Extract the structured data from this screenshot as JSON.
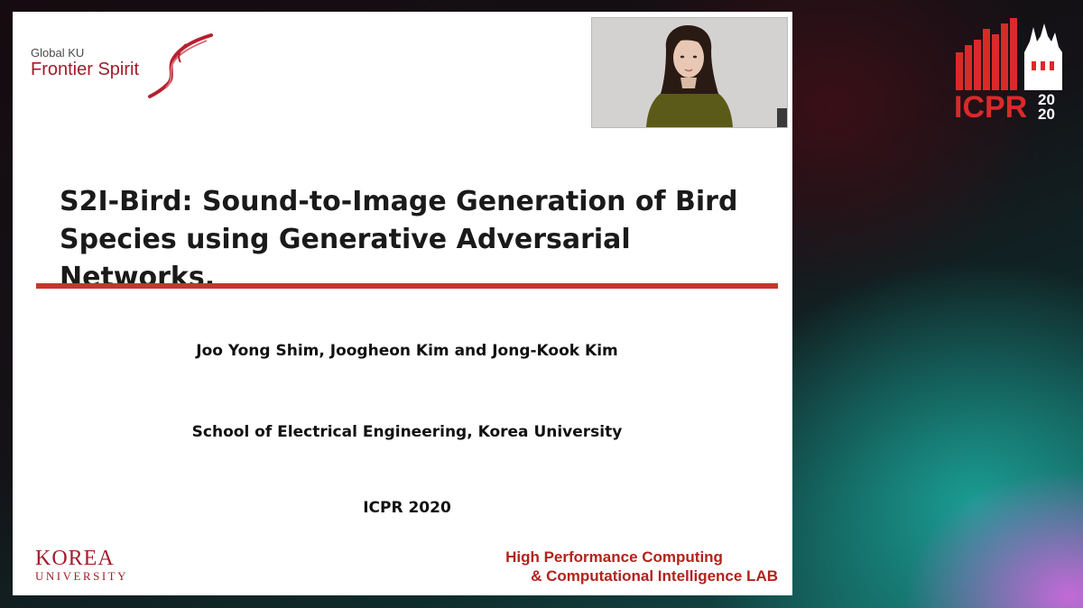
{
  "slide": {
    "logo_small": "Global KU",
    "logo_big": "Frontier Spirit",
    "title_line1": "S2I-Bird: Sound-to-Image Generation of Bird",
    "title_line2": "Species using Generative Adversarial Networks.",
    "authors": "Joo Yong Shim, Joogheon Kim and Jong-Kook Kim",
    "affiliation": "School of Electrical Engineering, Korea University",
    "conference": "ICPR 2020",
    "korea_top": "KOREA",
    "korea_bottom": "UNIVERSITY",
    "lab_line1": "High Performance Computing",
    "lab_line2": "& Computational Intelligence LAB"
  },
  "overlay": {
    "logo_text": "ICPR",
    "logo_year_top": "20",
    "logo_year_bottom": "20"
  },
  "colors": {
    "accent_red": "#c0392b",
    "brand_red": "#a31f2c"
  }
}
